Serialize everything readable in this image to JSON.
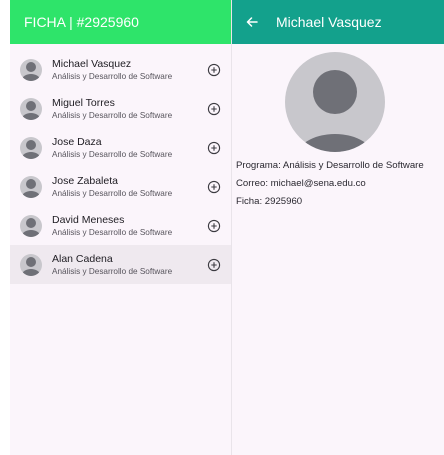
{
  "left_header": {
    "title": "FICHA | #2925960"
  },
  "list": [
    {
      "name": "Michael Vasquez",
      "program": "Análisis y Desarrollo de Software"
    },
    {
      "name": "Miguel Torres",
      "program": "Análisis y Desarrollo de Software"
    },
    {
      "name": "Jose Daza",
      "program": "Análisis y Desarrollo de Software"
    },
    {
      "name": "Jose Zabaleta",
      "program": "Análisis y Desarrollo de Software"
    },
    {
      "name": "David Meneses",
      "program": "Análisis y Desarrollo de Software"
    },
    {
      "name": "Alan Cadena",
      "program": "Análisis y Desarrollo de Software"
    }
  ],
  "detail_header": {
    "title": "Michael Vasquez"
  },
  "detail": {
    "programa": "Programa: Análisis y Desarrollo de Software",
    "correo": "Correo: michael@sena.edu.co",
    "ficha": "Ficha: 2925960"
  },
  "icons": {
    "back": "arrow-left-icon",
    "add": "add-circle-icon",
    "avatar": "person-avatar-icon"
  },
  "colors": {
    "left_header_bg": "#2ee46a",
    "right_header_bg": "#13a18c",
    "panel_bg": "#fbf5fb",
    "selected_row_bg": "#efe9ef"
  }
}
